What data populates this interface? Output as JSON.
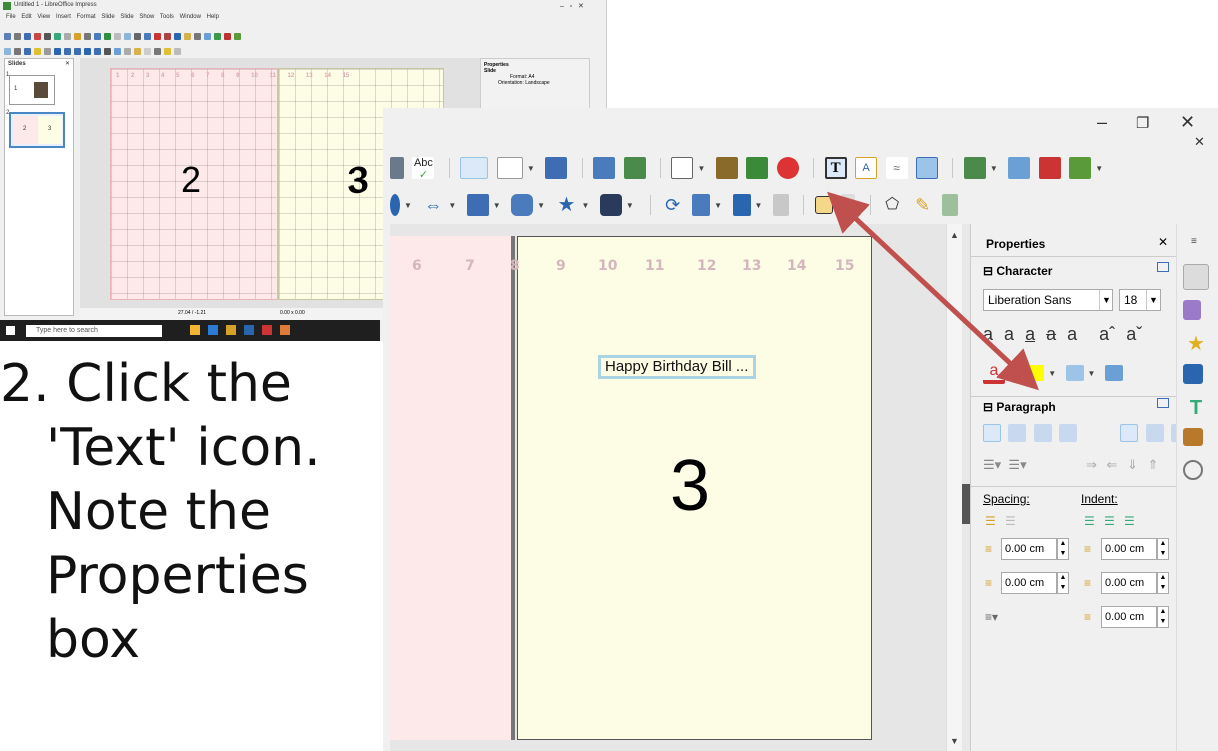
{
  "thumbnail": {
    "title": "Untitled 1 - LibreOffice Impress",
    "menu": [
      "File",
      "Edit",
      "View",
      "Insert",
      "Format",
      "Slide",
      "Slide Show",
      "Tools",
      "Window",
      "Help"
    ],
    "slides_panel_title": "Slides",
    "slide1_number": "1",
    "slide2_number": "2",
    "slide2_left": "2",
    "slide2_right": "3",
    "ruler": [
      "1",
      "2",
      "3",
      "4",
      "5",
      "6",
      "7",
      "8",
      "9",
      "10",
      "11",
      "12",
      "13",
      "14",
      "15"
    ],
    "page_left_number": "2",
    "page_right_number": "3",
    "properties_title": "Properties",
    "properties_section": "Slide",
    "format_label": "Format:",
    "format_value": "A4",
    "orientation_label": "Orientation:",
    "orientation_value": "Landscape",
    "status_position": "27.04 / -1.21",
    "status_size": "0.00 x 0.00",
    "search_placeholder": "Type here to search"
  },
  "instruction": [
    "2. Click the",
    "'Text' icon.",
    "Note the",
    "Properties",
    "box"
  ],
  "window": {
    "minimize": "–",
    "restore": "❐",
    "close": "✕",
    "doc_close": "✕"
  },
  "ruler_numbers": [
    "6",
    "7",
    "8",
    "9",
    "10",
    "11",
    "12",
    "13",
    "14",
    "15"
  ],
  "textbox": "Happy Birthday Bill ...",
  "page_number": "3",
  "clip_number": "3",
  "properties": {
    "title": "Properties",
    "close": "✕",
    "character_section": "Character",
    "font_name": "Liberation Sans",
    "font_size": "18",
    "paragraph_section": "Paragraph",
    "spacing_label": "Spacing:",
    "indent_label": "Indent:",
    "above": "0.00 cm",
    "below": "0.00 cm",
    "before_text": "0.00 cm",
    "after_text": "0.00 cm",
    "first_line": "0.00 cm"
  },
  "colors": {
    "arrow": "#c0504d",
    "highlight": "#aad3e3",
    "pink_page": "#fde8ea",
    "yellow_page": "#fdfde5"
  }
}
